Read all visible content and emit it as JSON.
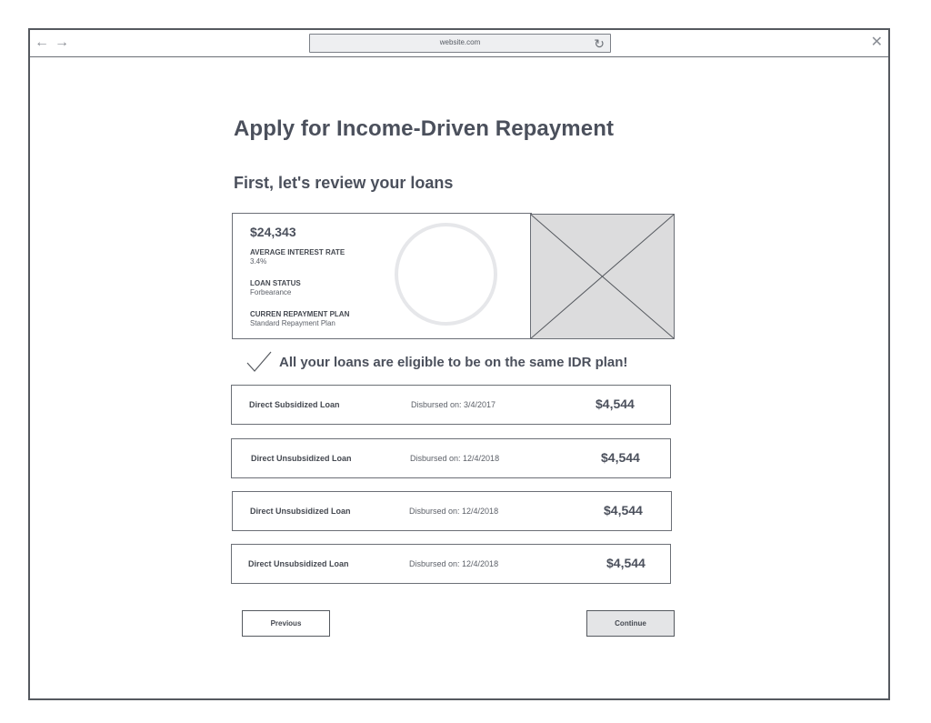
{
  "browser": {
    "back_icon": "←",
    "forward_icon": "→",
    "url": "website.com",
    "reload_icon": "↻",
    "close_icon": "✕"
  },
  "page": {
    "title": "Apply for Income-Driven Repayment",
    "subtitle": "First, let's review your loans"
  },
  "summary": {
    "amount": "$24,343",
    "fields": [
      {
        "label": "AVERAGE INTEREST RATE",
        "value": "3.4%"
      },
      {
        "label": "LOAN STATUS",
        "value": "Forbearance"
      },
      {
        "label": "CURREN REPAYMENT PLAN",
        "value": "Standard Repayment Plan"
      }
    ]
  },
  "eligibility": {
    "message": "All your loans are eligible to be on the same IDR plan!"
  },
  "loans": [
    {
      "name": "Direct Subsidized Loan",
      "disbursed": "Disbursed on: 3/4/2017",
      "amount": "$4,544"
    },
    {
      "name": "Direct Unsubsidized Loan",
      "disbursed": "Disbursed on: 12/4/2018",
      "amount": "$4,544"
    },
    {
      "name": "Direct Unsubsidized Loan",
      "disbursed": "Disbursed on: 12/4/2018",
      "amount": "$4,544"
    },
    {
      "name": "Direct Unsubsidized Loan",
      "disbursed": "Disbursed on: 12/4/2018",
      "amount": "$4,544"
    }
  ],
  "actions": {
    "previous_label": "Previous",
    "continue_label": "Continue"
  },
  "colors": {
    "border": "#55595f",
    "text": "#4b505c",
    "placeholder_fill": "#dcdcdd",
    "continue_fill": "#e4e5e7"
  }
}
